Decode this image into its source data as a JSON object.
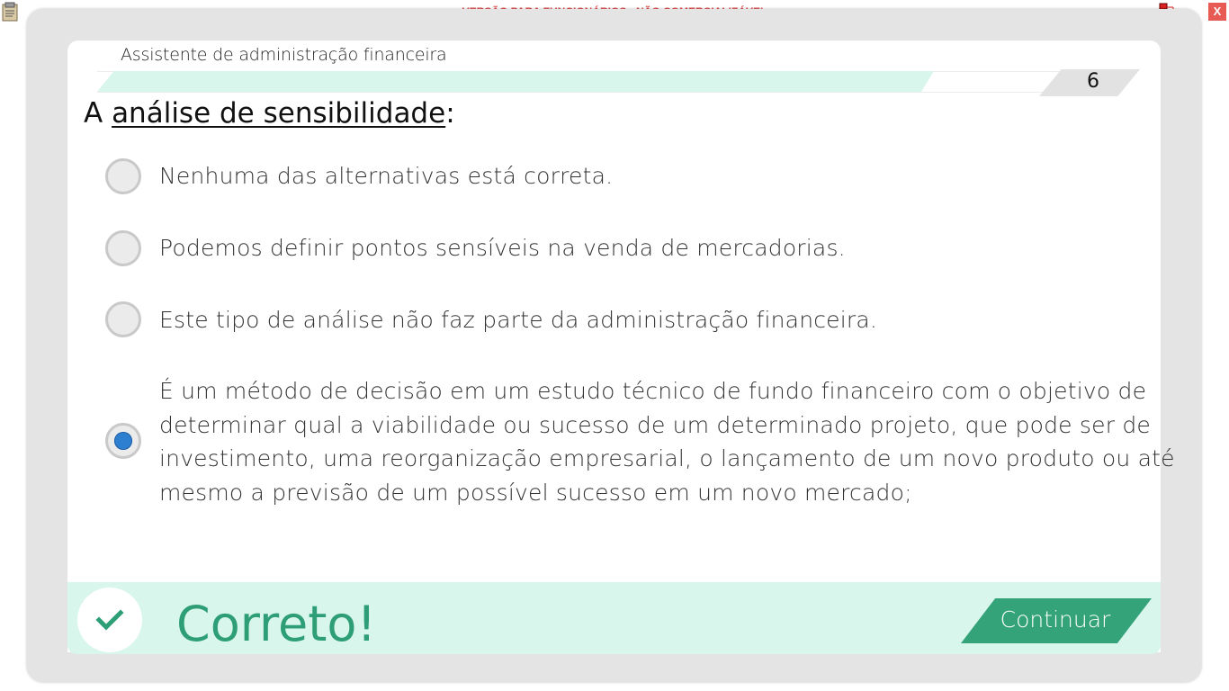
{
  "window": {
    "watermark": "VERSÃO PARA FUNCIONÁRIOS - NÃO COMERCIALIZÁVEL",
    "close_label": "X",
    "icons": [
      "clipboard-icon",
      "network-icon"
    ]
  },
  "course": {
    "title": "Assistente de administração financeira",
    "step": "6",
    "progress": 0.83
  },
  "question": {
    "prefix": "A ",
    "term": "análise de sensibilidade",
    "suffix": ":"
  },
  "options": [
    {
      "lines": [
        "Nenhuma das alternativas está correta."
      ],
      "selected": false
    },
    {
      "lines": [
        "Podemos definir pontos sensíveis na venda de mercadorias."
      ],
      "selected": false
    },
    {
      "lines": [
        "Este tipo de análise não faz parte da administração financeira."
      ],
      "selected": false
    },
    {
      "lines": [
        "É um método de decisão em um estudo técnico de fundo financeiro com o objetivo de",
        "determinar qual a viabilidade ou sucesso de um determinado projeto, que pode ser de",
        "investimento, uma reorganização empresarial, o lançamento de um novo produto ou até",
        "mesmo a previsão de um possível sucesso em um novo mercado;"
      ],
      "selected": true
    }
  ],
  "feedback": {
    "label": "Correto!",
    "continue_label": "Continuar"
  },
  "colors": {
    "accent": "#34a37a",
    "feedback_bg": "#d9f6ec",
    "watermark": "#e0504f",
    "radio_selected": "#2e7fd0"
  }
}
